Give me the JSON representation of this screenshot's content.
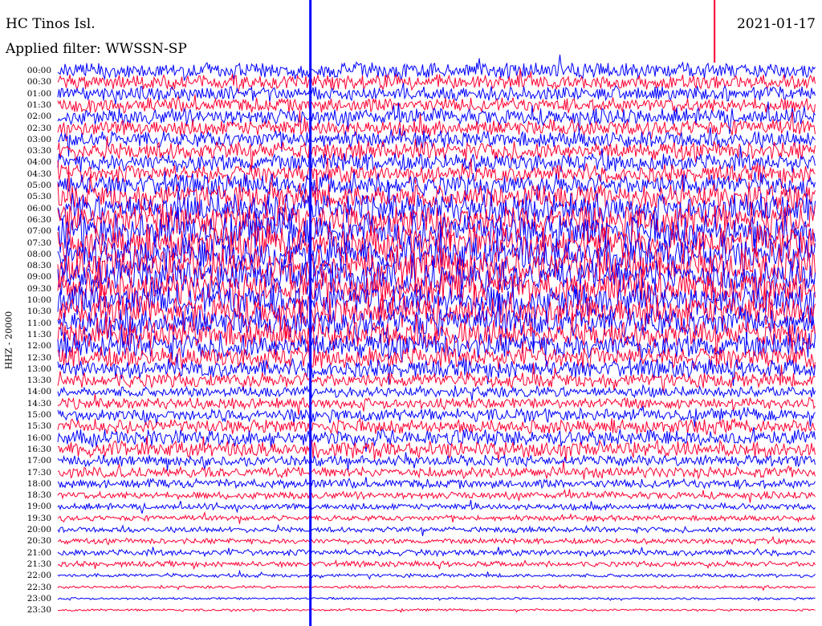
{
  "header": {
    "station": "HC Tinos Isl.",
    "filter": "Applied filter: WWSSN-SP",
    "date": "2021-01-17"
  },
  "chart_data": {
    "type": "line",
    "title": "HC Tinos Isl.",
    "subtitle": "Applied filter: WWSSN-SP",
    "ylabel": "HHZ - 20000",
    "yticks": [
      "00:00",
      "00:30",
      "01:00",
      "01:30",
      "02:00",
      "02:30",
      "03:00",
      "03:30",
      "04:00",
      "04:30",
      "05:00",
      "05:30",
      "06:00",
      "06:30",
      "07:00",
      "07:30",
      "08:00",
      "08:30",
      "09:00",
      "09:30",
      "10:00",
      "10:30",
      "11:00",
      "11:30",
      "12:00",
      "12:30",
      "13:00",
      "13:30",
      "14:00",
      "14:30",
      "15:00",
      "15:30",
      "16:00",
      "16:30",
      "17:00",
      "17:30",
      "18:00",
      "18:30",
      "19:00",
      "19:30",
      "20:00",
      "20:30",
      "21:00",
      "21:30",
      "22:00",
      "22:30",
      "23:00",
      "23:30"
    ],
    "colors": [
      "#0000ff",
      "#ff0033"
    ],
    "trace_amplitude": [
      0.9,
      0.8,
      0.8,
      0.8,
      0.9,
      0.9,
      0.9,
      1.0,
      1.0,
      1.0,
      1.2,
      1.4,
      1.6,
      1.8,
      1.9,
      1.9,
      1.9,
      1.9,
      1.9,
      1.8,
      1.8,
      1.7,
      1.6,
      1.5,
      1.4,
      1.2,
      1.0,
      0.8,
      0.6,
      0.6,
      0.7,
      0.8,
      0.9,
      0.9,
      0.6,
      0.6,
      0.5,
      0.4,
      0.35,
      0.3,
      0.3,
      0.3,
      0.35,
      0.3,
      0.2,
      0.15,
      0.12,
      0.12
    ],
    "events": [
      {
        "time": "00:10",
        "color": "#0000ff",
        "extent": "full-day"
      },
      {
        "time": "00:26",
        "color": "#ff0033",
        "extent": "top"
      }
    ]
  }
}
